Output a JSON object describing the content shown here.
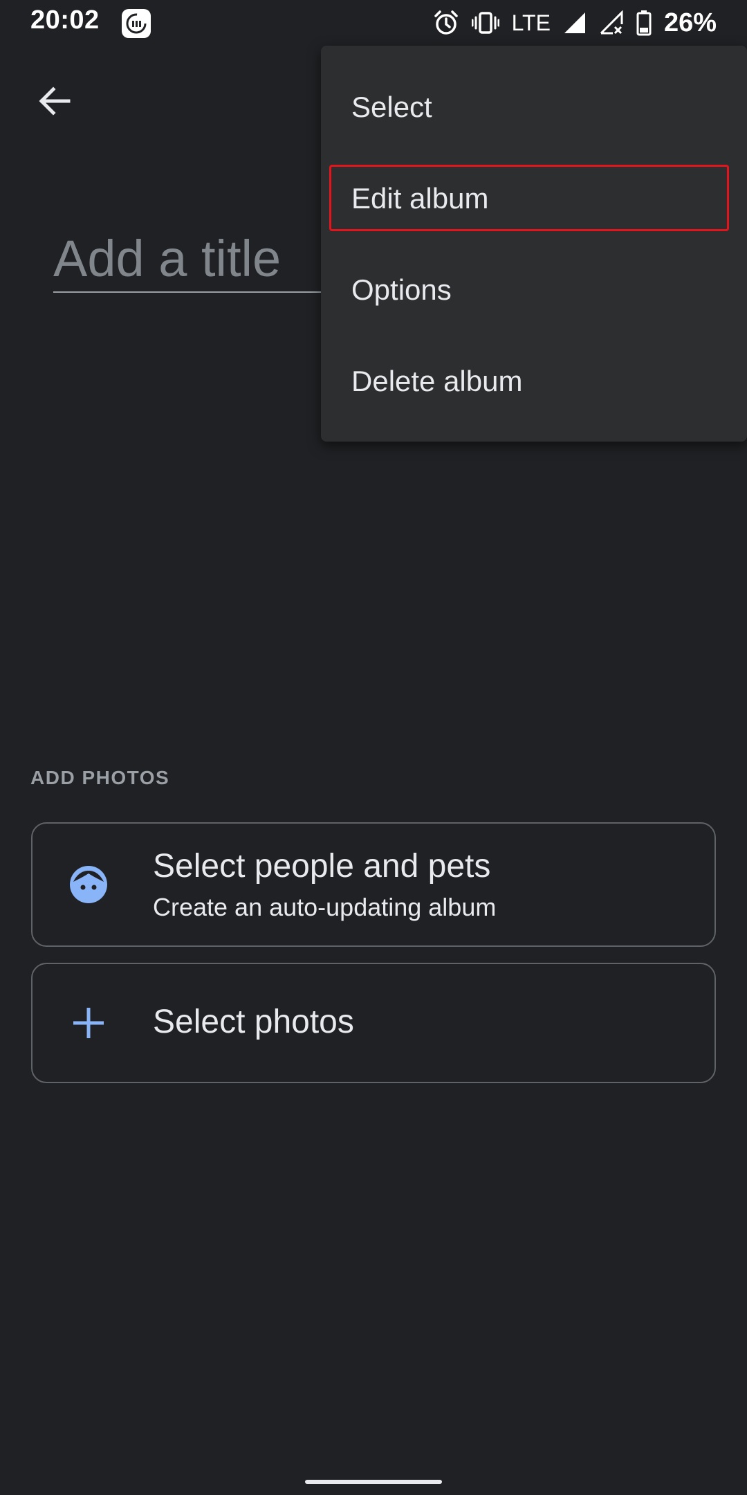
{
  "status_bar": {
    "time": "20:02",
    "network": "LTE",
    "battery": "26%"
  },
  "title_input": {
    "placeholder": "Add a title",
    "value": ""
  },
  "add_photos": {
    "section_label": "ADD PHOTOS",
    "people_card": {
      "title": "Select people and pets",
      "subtitle": "Create an auto-updating album",
      "icon": "face-icon"
    },
    "photos_card": {
      "title": "Select photos",
      "icon": "plus-icon"
    }
  },
  "menu": {
    "items": [
      {
        "label": "Select"
      },
      {
        "label": "Edit album"
      },
      {
        "label": "Options"
      },
      {
        "label": "Delete album"
      }
    ],
    "highlighted_item": "Edit album"
  },
  "colors": {
    "background": "#202124",
    "menu_background": "#2d2e30",
    "accent": "#8ab4f8",
    "highlight": "#e3141c"
  }
}
